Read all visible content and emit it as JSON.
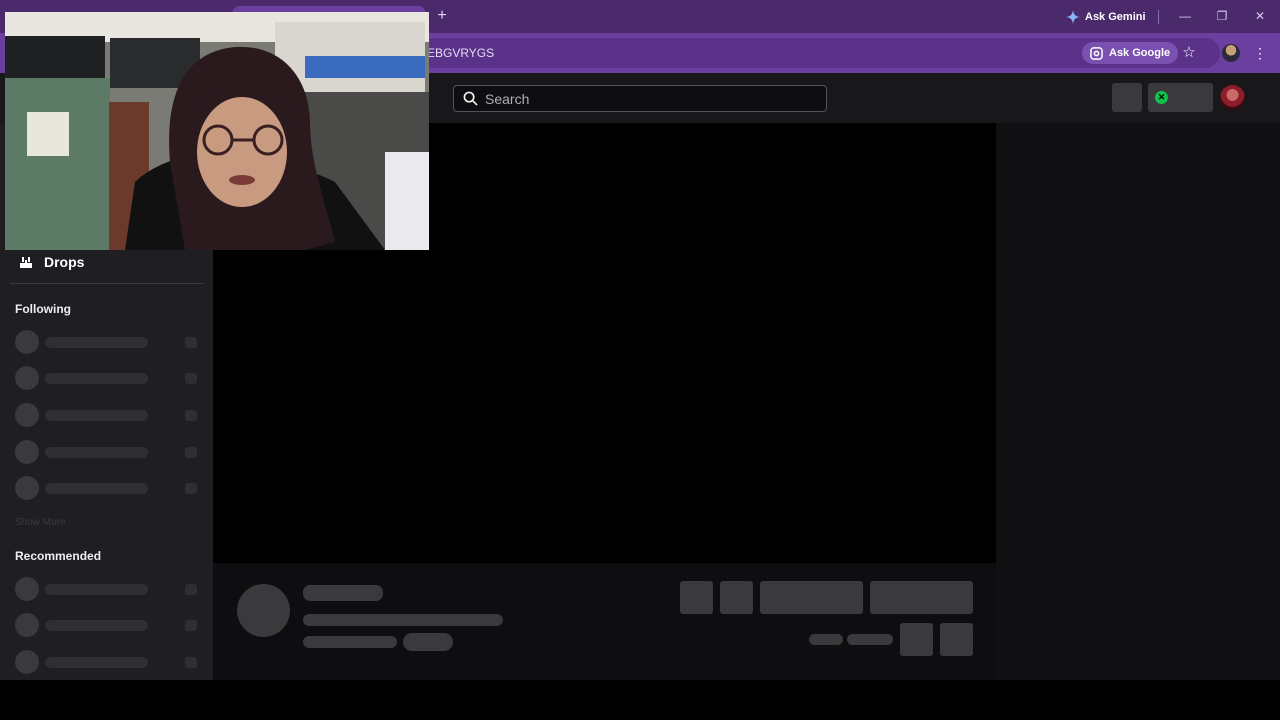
{
  "browser": {
    "gemini_label": "Ask Gemini",
    "new_tab_icon": "+",
    "address_text": "EBGVRYGS",
    "ask_google_label": "Ask Google",
    "accent_color": "#6b3fa0"
  },
  "header": {
    "search_placeholder": "Search"
  },
  "sidebar": {
    "drops_label": "Drops",
    "following_title": "Following",
    "show_more_label": "Show More",
    "recommended_title": "Recommended"
  }
}
